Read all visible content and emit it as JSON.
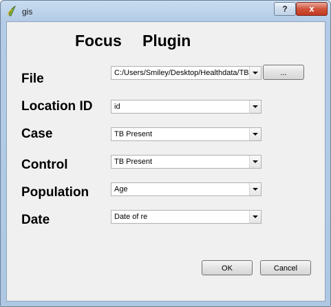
{
  "window": {
    "title": "gis",
    "help_label": "?",
    "close_label": "x"
  },
  "heading": {
    "word1": "Focus",
    "word2": "Plugin"
  },
  "fields": {
    "file": {
      "label": "File",
      "value": "C:/Users/Smiley/Desktop/Healthdata/TB.",
      "browse_label": "..."
    },
    "location_id": {
      "label": "Location ID",
      "value": "id"
    },
    "case": {
      "label": "Case",
      "value": "TB Present"
    },
    "control": {
      "label": "Control",
      "value": "TB Present"
    },
    "population": {
      "label": "Population",
      "value": "Age"
    },
    "date": {
      "label": "Date",
      "value": "Date of re"
    }
  },
  "buttons": {
    "ok": "OK",
    "cancel": "Cancel"
  },
  "colors": {
    "title_bar": "#b3cbe6",
    "close_button": "#c3391f",
    "dialog_bg": "#f0f0f0"
  },
  "icons": {
    "app": "qgis-icon",
    "dropdown": "chevron-down-icon"
  }
}
